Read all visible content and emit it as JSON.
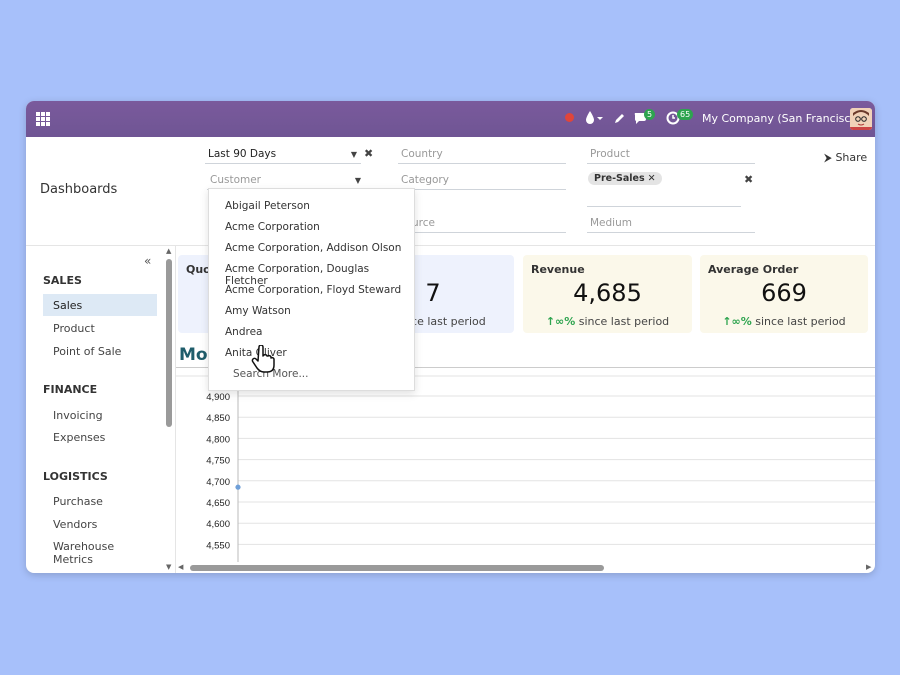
{
  "navbar": {
    "company": "My Company (San Francisco)",
    "chat_badge": "5",
    "activity_badge": "65",
    "icons": [
      "apps-icon",
      "record-icon",
      "drop-icon",
      "edit-icon",
      "chat-icon",
      "activity-icon"
    ],
    "brand_color": "#714b8f"
  },
  "control": {
    "breadcrumb": "Dashboards",
    "share_label": "Share",
    "filters": {
      "date": "Last 90 Days",
      "customer_placeholder": "Customer",
      "country_placeholder": "Country",
      "category_placeholder": "Category",
      "source_placeholder": "urce",
      "product_placeholder": "Product",
      "product_tag": "Pre-Sales",
      "medium_placeholder": "Medium"
    }
  },
  "sidebar": {
    "sections": [
      {
        "title": "SALES",
        "items": [
          "Sales",
          "Product",
          "Point of Sale"
        ]
      },
      {
        "title": "FINANCE",
        "items": [
          "Invoicing",
          "Expenses"
        ]
      },
      {
        "title": "LOGISTICS",
        "items": [
          "Purchase",
          "Vendors",
          "Warehouse Metrics"
        ]
      }
    ],
    "active": "Sales"
  },
  "kpis": [
    {
      "title": "Quot",
      "value": "",
      "delta": ""
    },
    {
      "title": "",
      "value": "7",
      "delta": "ince last period"
    },
    {
      "title": "Revenue",
      "value": "4,685",
      "delta_arrow": "↑∞%",
      "delta": "since last period"
    },
    {
      "title": "Average Order",
      "value": "669",
      "delta_arrow": "↑∞%",
      "delta": "since last period"
    }
  ],
  "section_title": "Mor",
  "customer_dropdown": {
    "options": [
      "Abigail Peterson",
      "Acme Corporation",
      "Acme Corporation, Addison Olson",
      "Acme Corporation, Douglas Fletcher",
      "Acme Corporation, Floyd Steward",
      "Amy Watson",
      "Andrea",
      "Anita Oliver"
    ],
    "search_more": "Search More..."
  },
  "chart_data": {
    "type": "line",
    "yticks": [
      "4,900",
      "4,850",
      "4,800",
      "4,750",
      "4,700",
      "4,650",
      "4,600",
      "4,550"
    ],
    "ylim": [
      4550,
      4900
    ],
    "series": [
      {
        "values": [
          4685
        ]
      }
    ]
  }
}
